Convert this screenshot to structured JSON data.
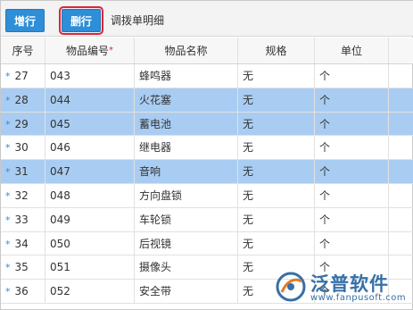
{
  "toolbar": {
    "add_label": "增行",
    "delete_label": "删行",
    "title": "调拨单明细"
  },
  "columns": {
    "index": "序号",
    "code": "物品编号",
    "code_required": "*",
    "name": "物品名称",
    "spec": "规格",
    "unit": "单位"
  },
  "row_marker": "*",
  "rows": [
    {
      "index": "27",
      "code": "043",
      "name": "蜂鸣器",
      "spec": "无",
      "unit": "个",
      "selected": false
    },
    {
      "index": "28",
      "code": "044",
      "name": "火花塞",
      "spec": "无",
      "unit": "个",
      "selected": true
    },
    {
      "index": "29",
      "code": "045",
      "name": "蓄电池",
      "spec": "无",
      "unit": "个",
      "selected": true
    },
    {
      "index": "30",
      "code": "046",
      "name": "继电器",
      "spec": "无",
      "unit": "个",
      "selected": false
    },
    {
      "index": "31",
      "code": "047",
      "name": "音响",
      "spec": "无",
      "unit": "个",
      "selected": true
    },
    {
      "index": "32",
      "code": "048",
      "name": "方向盘锁",
      "spec": "无",
      "unit": "个",
      "selected": false
    },
    {
      "index": "33",
      "code": "049",
      "name": "车轮锁",
      "spec": "无",
      "unit": "个",
      "selected": false
    },
    {
      "index": "34",
      "code": "050",
      "name": "后视镜",
      "spec": "无",
      "unit": "个",
      "selected": false
    },
    {
      "index": "35",
      "code": "051",
      "name": "摄像头",
      "spec": "无",
      "unit": "个",
      "selected": false
    },
    {
      "index": "36",
      "code": "052",
      "name": "安全带",
      "spec": "无",
      "unit": "个",
      "selected": false
    }
  ],
  "watermark": {
    "brand": "泛普软件",
    "url": "www.fanpusoft.com"
  },
  "colors": {
    "button": "#2e8ed7",
    "selected_row": "#a9cdf2",
    "delete_highlight": "#d9263a"
  }
}
